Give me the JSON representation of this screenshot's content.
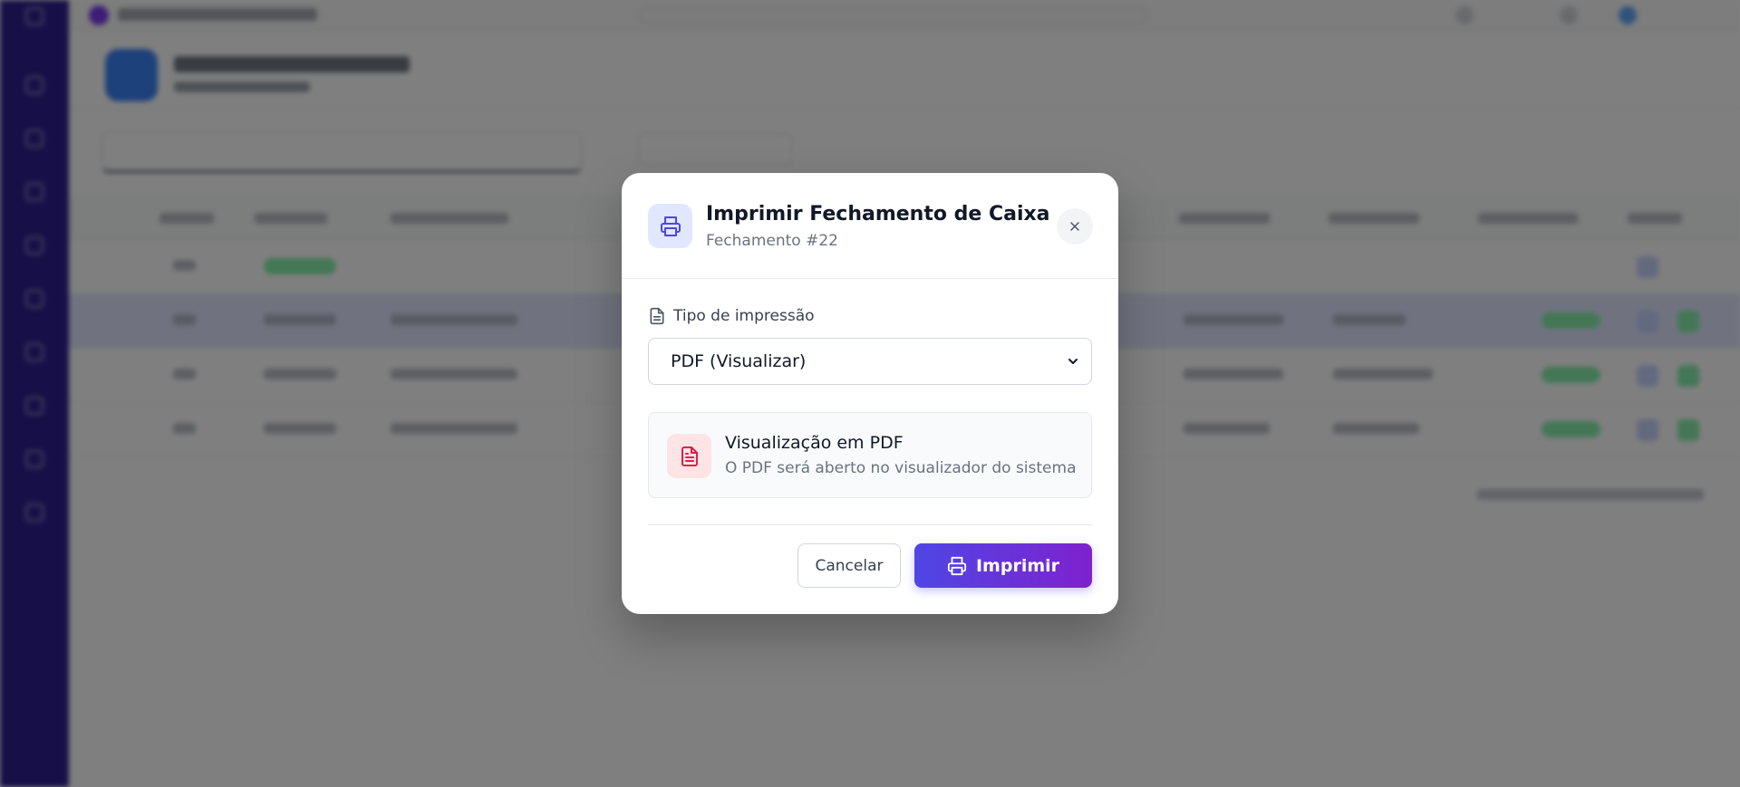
{
  "modal": {
    "title": "Imprimir Fechamento de Caixa",
    "subtitle": "Fechamento #22",
    "field_label": "Tipo de impressão",
    "select_value": "PDF (Visualizar)",
    "info_title": "Visualização em PDF",
    "info_description": "O PDF será aberto no visualizador do sistema",
    "cancel_label": "Cancelar",
    "print_label": "Imprimir"
  },
  "colors": {
    "accent": "#4f46e5",
    "accent_end": "#7e22ce",
    "pdf_icon": "#e11d48",
    "sidebar": "#2e1f8f"
  },
  "icons": {
    "header": "printer-icon",
    "close": "close-icon",
    "label": "file-text-icon",
    "select": "chevron-down-icon",
    "info": "file-pdf-icon",
    "print": "printer-icon"
  }
}
